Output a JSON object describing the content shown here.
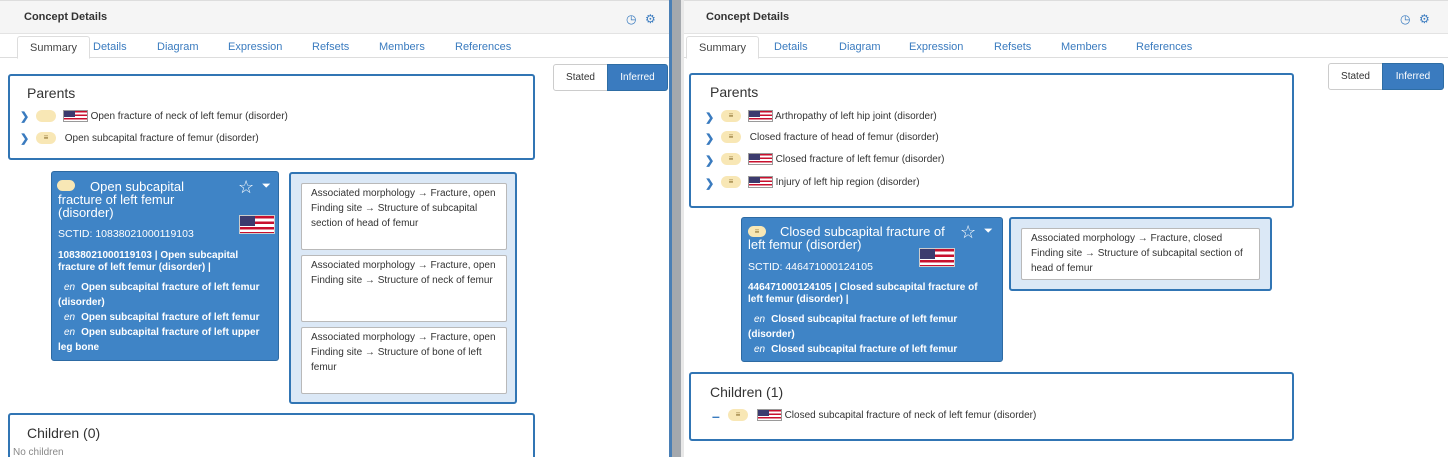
{
  "left": {
    "title": "Concept Details",
    "tabs": [
      "Summary",
      "Details",
      "Diagram",
      "Expression",
      "Refsets",
      "Members",
      "References"
    ],
    "toggle": {
      "stated": "Stated",
      "inferred": "Inferred"
    },
    "parents_title": "Parents",
    "parents": [
      {
        "label": "Open fracture of neck of left femur (disorder)"
      },
      {
        "label": "Open subcapital fracture of femur (disorder)"
      }
    ],
    "concept": {
      "title": "Open subcapital fracture of left femur (disorder)",
      "sctid": "SCTID: 10838021000119103",
      "fsn_line": "10838021000119103 | Open subcapital fracture of left femur (disorder) |",
      "descriptions": [
        {
          "lang": "en",
          "text": "Open subcapital fracture of left femur (disorder)"
        },
        {
          "lang": "en",
          "text": "Open subcapital fracture of left femur"
        },
        {
          "lang": "en",
          "text": "Open subcapital fracture of left upper leg bone"
        }
      ]
    },
    "attributes": [
      {
        "l1": "Associated morphology →  Fracture, open",
        "l2": "Finding site →  Structure of subcapital section of head of femur"
      },
      {
        "l1": "Associated morphology →  Fracture, open",
        "l2": "Finding site →  Structure of neck of femur"
      },
      {
        "l1": "Associated morphology →  Fracture, open",
        "l2": "Finding site →  Structure of bone of left femur"
      }
    ],
    "children_title": "Children (0)",
    "children_empty": "No children"
  },
  "right": {
    "title": "Concept Details",
    "tabs": [
      "Summary",
      "Details",
      "Diagram",
      "Expression",
      "Refsets",
      "Members",
      "References"
    ],
    "toggle": {
      "stated": "Stated",
      "inferred": "Inferred"
    },
    "parents_title": "Parents",
    "parents": [
      {
        "label": "Arthropathy of left hip joint (disorder)"
      },
      {
        "label": "Closed fracture of head of femur (disorder)"
      },
      {
        "label": "Closed fracture of left femur (disorder)"
      },
      {
        "label": "Injury of left hip region (disorder)"
      }
    ],
    "concept": {
      "title": "Closed subcapital fracture of left femur (disorder)",
      "sctid": "SCTID: 446471000124105",
      "fsn_line": "446471000124105 | Closed subcapital fracture of left femur (disorder) |",
      "descriptions": [
        {
          "lang": "en",
          "text": "Closed subcapital fracture of left femur (disorder)"
        },
        {
          "lang": "en",
          "text": "Closed subcapital fracture of left femur"
        }
      ]
    },
    "attributes": [
      {
        "l1": "Associated morphology →  Fracture, closed",
        "l2": "Finding site →  Structure of subcapital section of head of femur"
      }
    ],
    "children_title": "Children (1)",
    "children": [
      {
        "label": "Closed subcapital fracture of neck of left femur (disorder)"
      }
    ]
  },
  "colors": {
    "accent": "#3a7bbf",
    "card": "#3f84c6",
    "border": "#3175b4"
  }
}
